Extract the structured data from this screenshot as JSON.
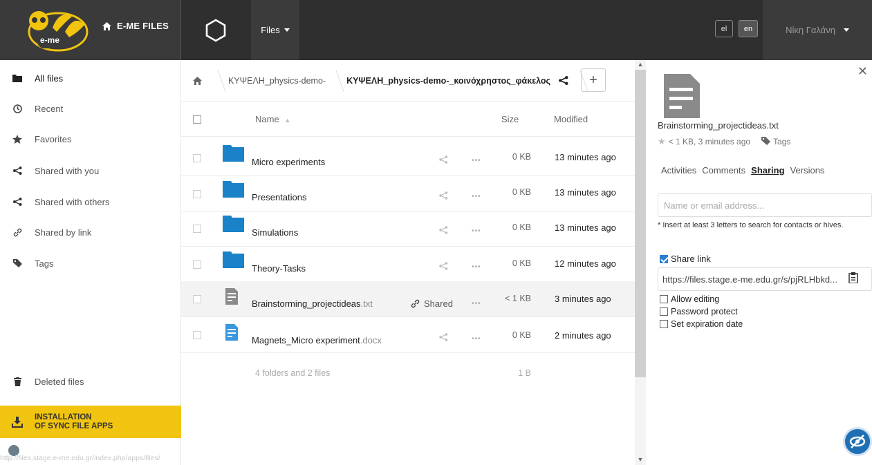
{
  "topbar": {
    "logo_text": "e-me",
    "home_label": "E-ME FILES",
    "files_menu_label": "Files",
    "lang_el": "el",
    "lang_en": "en",
    "user_name": "Νίκη Γαλάνη"
  },
  "sidebar": {
    "items": [
      {
        "label": "All files",
        "icon": "folder-icon"
      },
      {
        "label": "Recent",
        "icon": "clock-icon"
      },
      {
        "label": "Favorites",
        "icon": "star-icon"
      },
      {
        "label": "Shared with you",
        "icon": "share-icon"
      },
      {
        "label": "Shared with others",
        "icon": "share-icon"
      },
      {
        "label": "Shared by link",
        "icon": "link-icon"
      },
      {
        "label": "Tags",
        "icon": "tag-icon"
      }
    ],
    "deleted_label": "Deleted files",
    "install_line1": "INSTALLATION",
    "install_line2": "OF SYNC FILE APPS",
    "status_url": "http://files.stage.e-me.edu.gr/index.php/apps/files/"
  },
  "breadcrumb": {
    "items": [
      "ΚΥΨΕΛΗ_physics-demo-",
      "ΚΥΨΕΛΗ_physics-demo-_κοινόχρηστος_φάκελος"
    ],
    "add_label": "+"
  },
  "table": {
    "headers": {
      "name": "Name",
      "size": "Size",
      "modified": "Modified"
    },
    "rows": [
      {
        "name": "Micro experiments",
        "ext": "",
        "type": "folder",
        "size": "0 KB",
        "modified": "13 minutes ago",
        "shared": false
      },
      {
        "name": "Presentations",
        "ext": "",
        "type": "folder",
        "size": "0 KB",
        "modified": "13 minutes ago",
        "shared": false
      },
      {
        "name": "Simulations",
        "ext": "",
        "type": "folder",
        "size": "0 KB",
        "modified": "13 minutes ago",
        "shared": false
      },
      {
        "name": "Theory-Tasks",
        "ext": "",
        "type": "folder",
        "size": "0 KB",
        "modified": "12 minutes ago",
        "shared": false
      },
      {
        "name": "Brainstorming_projectideas",
        "ext": ".txt",
        "type": "txt",
        "size": "< 1 KB",
        "modified": "3 minutes ago",
        "shared": true
      },
      {
        "name": "Magnets_Micro experiment",
        "ext": ".docx",
        "type": "docx",
        "size": "0 KB",
        "modified": "2 minutes ago",
        "shared": false
      }
    ],
    "shared_label": "Shared",
    "summary_text": "4 folders and 2 files",
    "summary_size": "1 B"
  },
  "details": {
    "filename": "Brainstorming_projectideas.txt",
    "meta": "< 1 KB, 3 minutes ago",
    "tags_label": "Tags",
    "tabs": [
      "Activities",
      "Comments",
      "Sharing",
      "Versions"
    ],
    "active_tab": "Sharing",
    "share_placeholder": "Name or email address...",
    "hint": "* Insert at least 3 letters to search for contacts or hives.",
    "share_link_label": "Share link",
    "share_link_url": "https://files.stage.e-me.edu.gr/s/pjRLHbkd...",
    "allow_editing": "Allow editing",
    "password_protect": "Password protect",
    "set_expiration": "Set expiration date"
  },
  "colors": {
    "accent": "#2a7fd4",
    "folder": "#1a82c9",
    "install_bg": "#f1c40f",
    "topbar": "#2f2f2f"
  }
}
